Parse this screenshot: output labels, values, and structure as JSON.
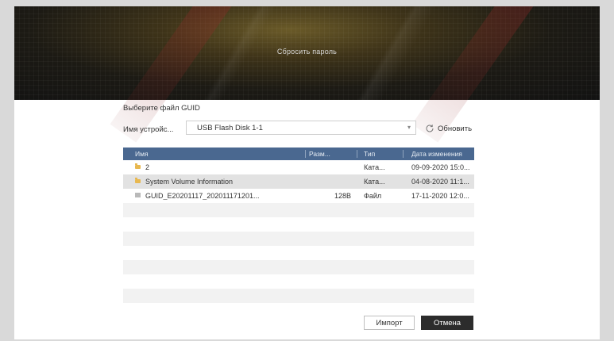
{
  "banner": {
    "title": "Сбросить пароль"
  },
  "dialog": {
    "section_title": "Выберите файл GUID",
    "device_label": "Имя устройс...",
    "device_value": "USB Flash Disk 1-1",
    "refresh_label": "Обновить"
  },
  "table": {
    "columns": {
      "name": "Имя",
      "size": "Разм...",
      "type": "Тип",
      "modified": "Дата изменения"
    },
    "rows": [
      {
        "icon": "folder-icon",
        "name": "2",
        "size": "",
        "type": "Ката...",
        "modified": "09-09-2020 15:0..."
      },
      {
        "icon": "folder-icon",
        "name": "System Volume Information",
        "size": "",
        "type": "Ката...",
        "modified": "04-08-2020 11:1..."
      },
      {
        "icon": "file-icon",
        "name": "GUID_E20201117_202011171201...",
        "size": "128B",
        "type": "Файл",
        "modified": "17-11-2020 12:0..."
      }
    ],
    "selected_row": 1
  },
  "buttons": {
    "import": "Импорт",
    "cancel": "Отмена"
  },
  "colors": {
    "header": "#4a6890",
    "cancel_bg": "#2c2c2c",
    "folder": "#e8b850"
  }
}
